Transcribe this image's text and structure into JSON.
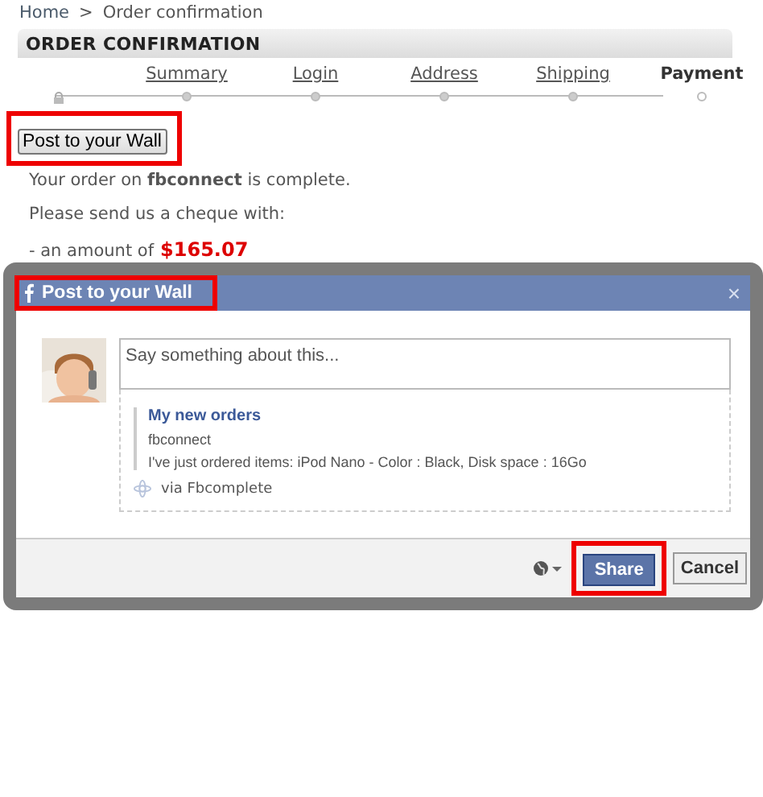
{
  "breadcrumb": {
    "home": "Home",
    "separator": ">",
    "current": "Order confirmation"
  },
  "header": {
    "title": "ORDER CONFIRMATION"
  },
  "steps": [
    {
      "label": "Summary",
      "selected": false
    },
    {
      "label": "Login",
      "selected": false
    },
    {
      "label": "Address",
      "selected": false
    },
    {
      "label": "Shipping",
      "selected": false
    },
    {
      "label": "Payment",
      "selected": true
    }
  ],
  "post_button": {
    "label": "Post to your Wall",
    "highlighted": true
  },
  "message": {
    "text": "Your order on **fbconnect** is complete.",
    "cheque": "Please send us a cheque with:",
    "amount_prefix": "- an amount of",
    "amount": "$165.07"
  },
  "dialog": {
    "title": "Post to your Wall",
    "title_highlighted": true,
    "close": "×",
    "placeholder": "Say something about this...",
    "attachment": {
      "title": "My new orders",
      "caption": "fbconnect",
      "description": "I've just ordered items: iPod Nano - Color : Black, Disk space : 16Go",
      "via": "via Fbcomplete"
    },
    "share": {
      "label": "Share",
      "highlighted": true
    },
    "cancel": "Cancel"
  }
}
